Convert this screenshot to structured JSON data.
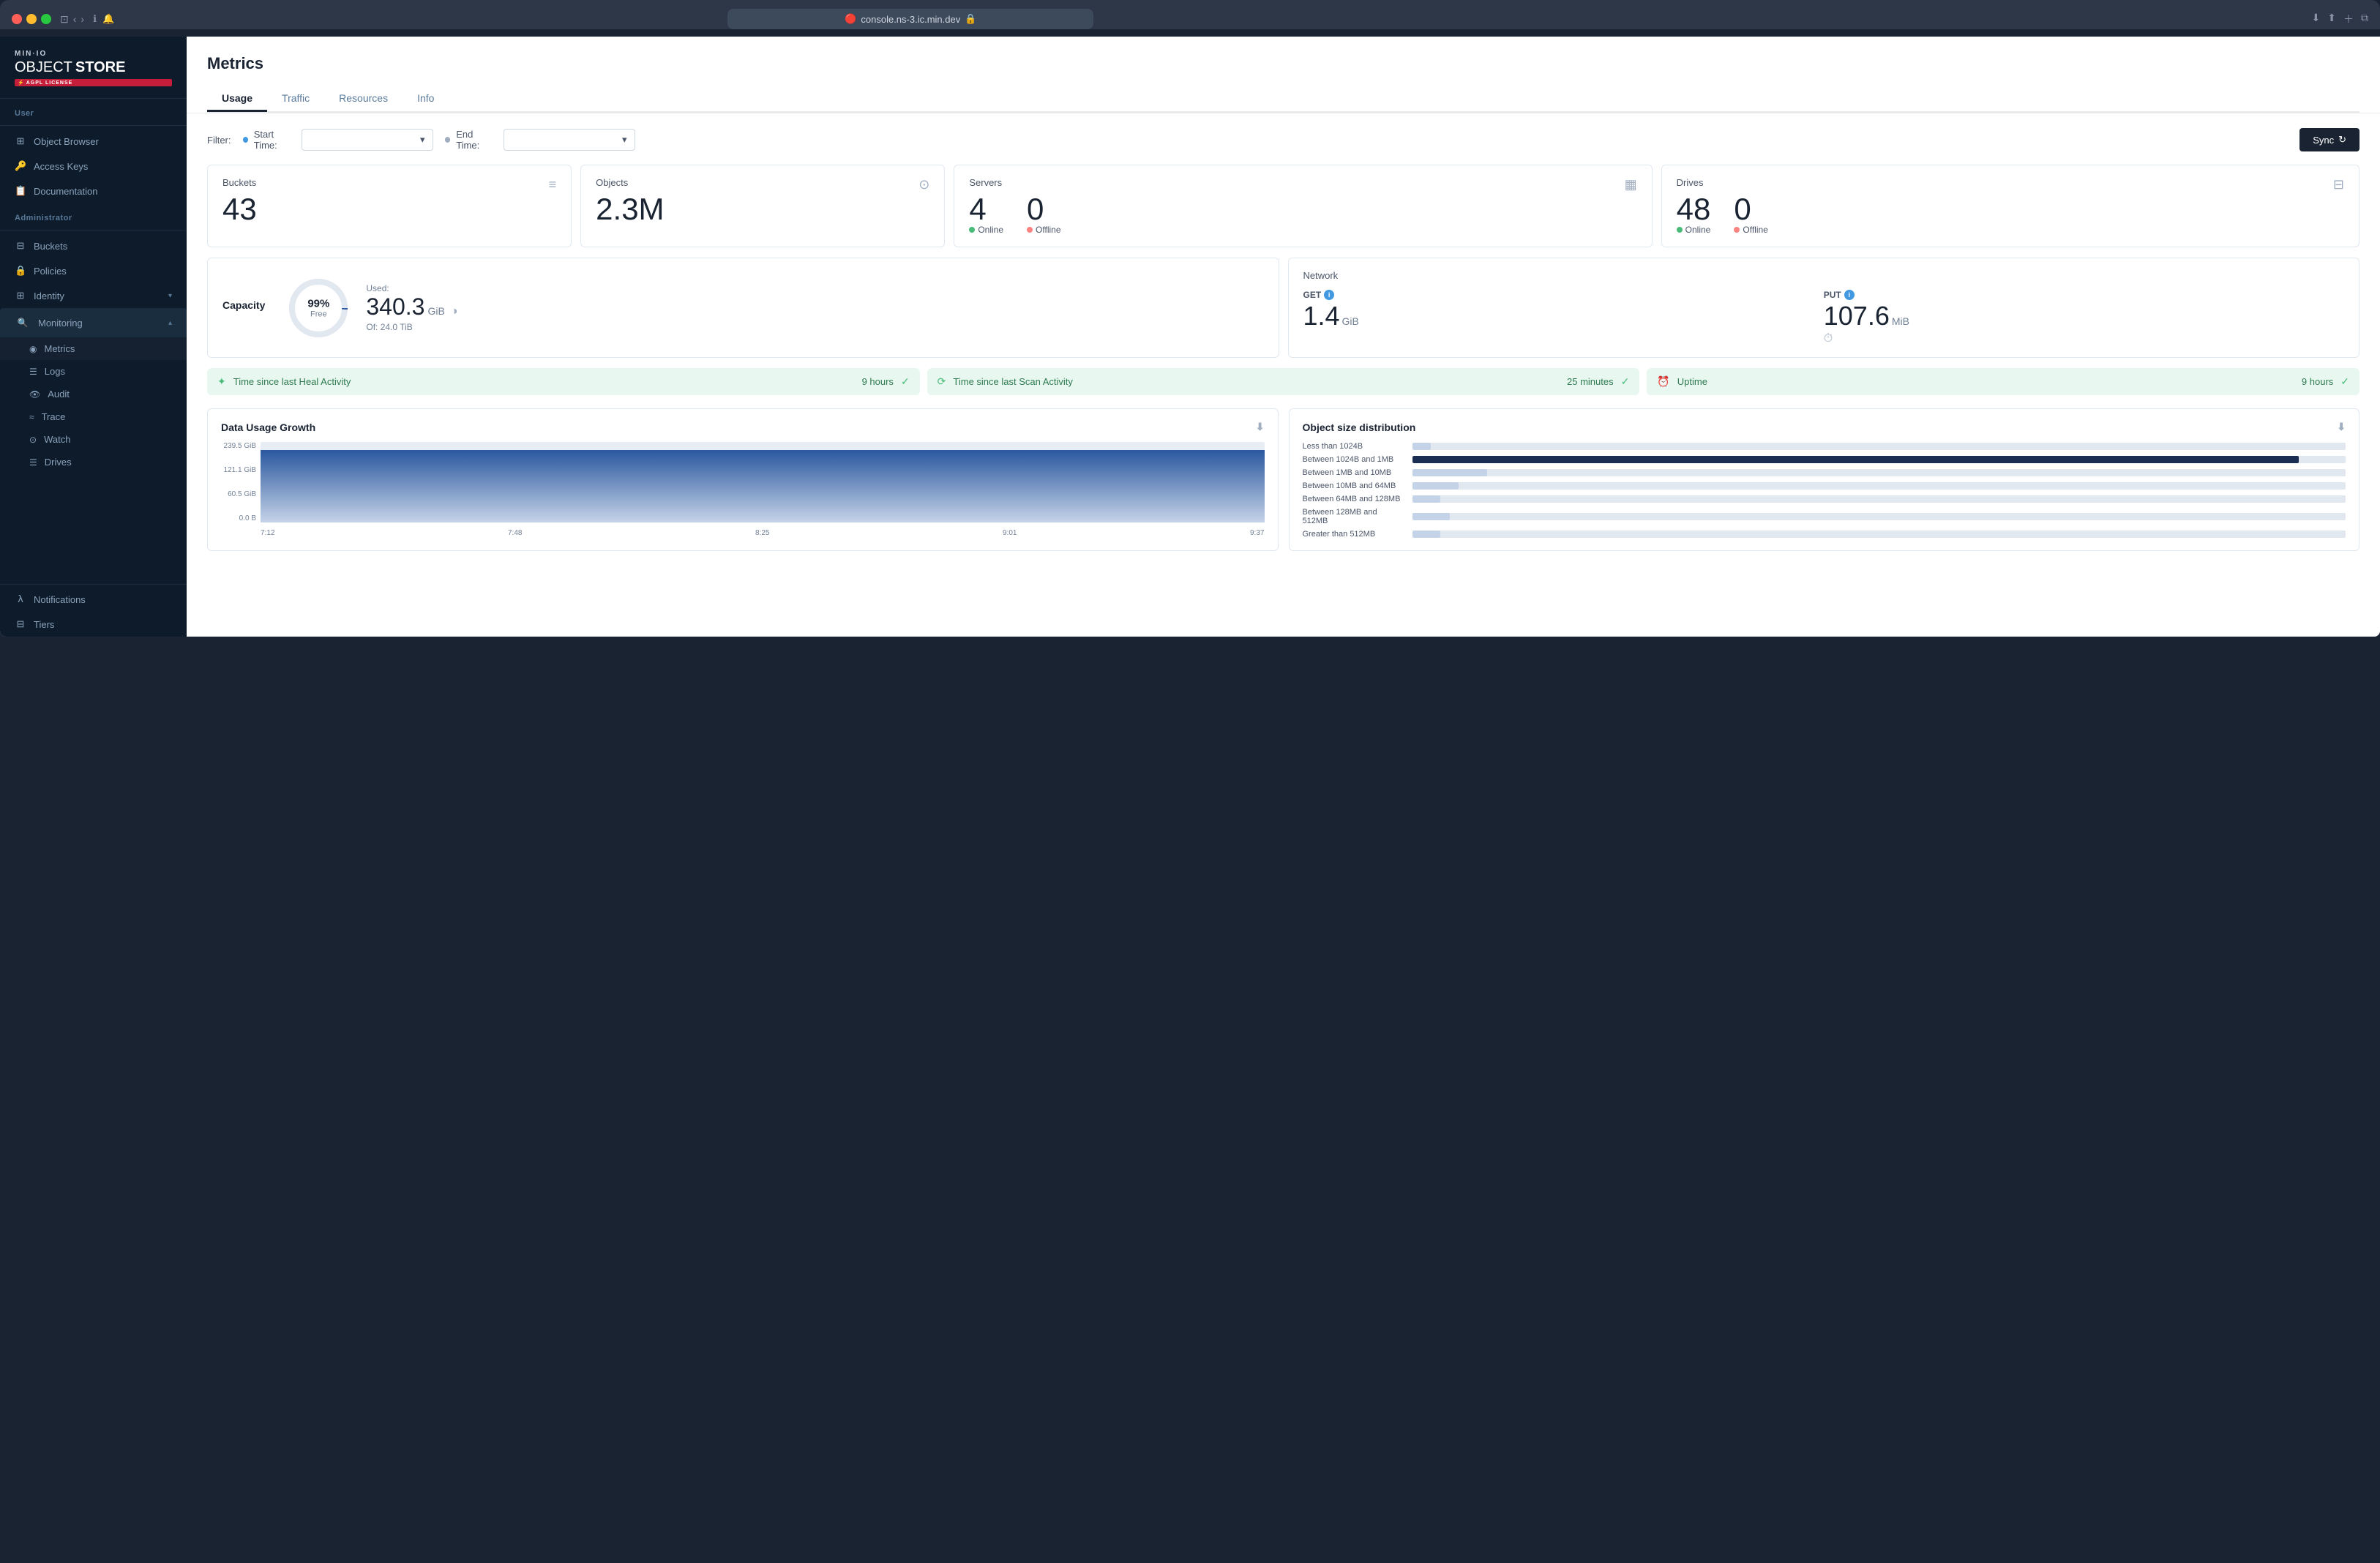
{
  "browser": {
    "url": "console.ns-3.ic.min.dev",
    "lock_icon": "🔒"
  },
  "sidebar": {
    "logo": {
      "minio": "MIN·IO",
      "object": "OBJECT",
      "store": " STORE",
      "badge": "AGPL LICENSE"
    },
    "user_section": "User",
    "admin_section": "Administrator",
    "items_user": [
      {
        "id": "object-browser",
        "label": "Object Browser",
        "icon": "⊞"
      },
      {
        "id": "access-keys",
        "label": "Access Keys",
        "icon": "⚿"
      },
      {
        "id": "documentation",
        "label": "Documentation",
        "icon": "📄"
      }
    ],
    "items_admin": [
      {
        "id": "buckets",
        "label": "Buckets",
        "icon": "⊟"
      },
      {
        "id": "policies",
        "label": "Policies",
        "icon": "🔒"
      },
      {
        "id": "identity",
        "label": "Identity",
        "icon": "⊞",
        "has_chevron": true
      },
      {
        "id": "monitoring",
        "label": "Monitoring",
        "icon": "🔍",
        "active": true,
        "has_chevron": true
      }
    ],
    "monitoring_sub": [
      {
        "id": "metrics",
        "label": "Metrics",
        "active": true
      },
      {
        "id": "logs",
        "label": "Logs"
      },
      {
        "id": "audit",
        "label": "Audit"
      },
      {
        "id": "trace",
        "label": "Trace"
      },
      {
        "id": "watch",
        "label": "Watch"
      },
      {
        "id": "drives",
        "label": "Drives"
      }
    ],
    "items_bottom": [
      {
        "id": "notifications",
        "label": "Notifications",
        "icon": "λ"
      },
      {
        "id": "tiers",
        "label": "Tiers",
        "icon": "⊟"
      }
    ]
  },
  "page": {
    "title": "Metrics",
    "tabs": [
      "Usage",
      "Traffic",
      "Resources",
      "Info"
    ],
    "active_tab": "Usage"
  },
  "filter": {
    "label": "Filter:",
    "start_time_label": "Start Time:",
    "end_time_label": "End Time:",
    "sync_button": "Sync",
    "sync_icon": "↻"
  },
  "stats": {
    "buckets": {
      "label": "Buckets",
      "value": "43"
    },
    "objects": {
      "label": "Objects",
      "value": "2.3M"
    },
    "servers": {
      "label": "Servers",
      "online": "4",
      "offline": "0",
      "online_label": "Online",
      "offline_label": "Offline"
    },
    "drives": {
      "label": "Drives",
      "online": "48",
      "offline": "0",
      "online_label": "Online",
      "offline_label": "Offline"
    }
  },
  "capacity": {
    "label": "Capacity",
    "percent": "99%",
    "free_label": "Free",
    "used_label": "Used:",
    "used_value": "340.3",
    "used_unit": "GiB",
    "of_label": "Of: 24.0 TiB"
  },
  "network": {
    "label": "Network",
    "get": {
      "label": "GET",
      "value": "1.4",
      "unit": "GiB"
    },
    "put": {
      "label": "PUT",
      "value": "107.6",
      "unit": "MiB"
    }
  },
  "activity": [
    {
      "id": "heal",
      "text": "Time since last Heal Activity",
      "value": "9 hours"
    },
    {
      "id": "scan",
      "text": "Time since last Scan Activity",
      "value": "25 minutes"
    },
    {
      "id": "uptime",
      "text": "Uptime",
      "value": "9 hours"
    }
  ],
  "data_usage_chart": {
    "title": "Data Usage Growth",
    "y_labels": [
      "239.5 GiB",
      "121.1 GiB",
      "60.5 GiB",
      "0.0 B"
    ],
    "x_labels": [
      "7:12",
      "7:48",
      "8:25",
      "9:01",
      "9:37"
    ],
    "fill_height_percent": 90
  },
  "object_dist_chart": {
    "title": "Object size distribution",
    "items": [
      {
        "label": "Less than 1024B",
        "bar_pct": 2
      },
      {
        "label": "Between 1024B and 1MB",
        "bar_pct": 95,
        "is_large": true
      },
      {
        "label": "Between 1MB and 10MB",
        "bar_pct": 8
      },
      {
        "label": "Between 10MB and 64MB",
        "bar_pct": 5
      },
      {
        "label": "Between 64MB and 128MB",
        "bar_pct": 3
      },
      {
        "label": "Between 128MB and 512MB",
        "bar_pct": 4
      },
      {
        "label": "Greater than 512MB",
        "bar_pct": 3
      }
    ]
  }
}
